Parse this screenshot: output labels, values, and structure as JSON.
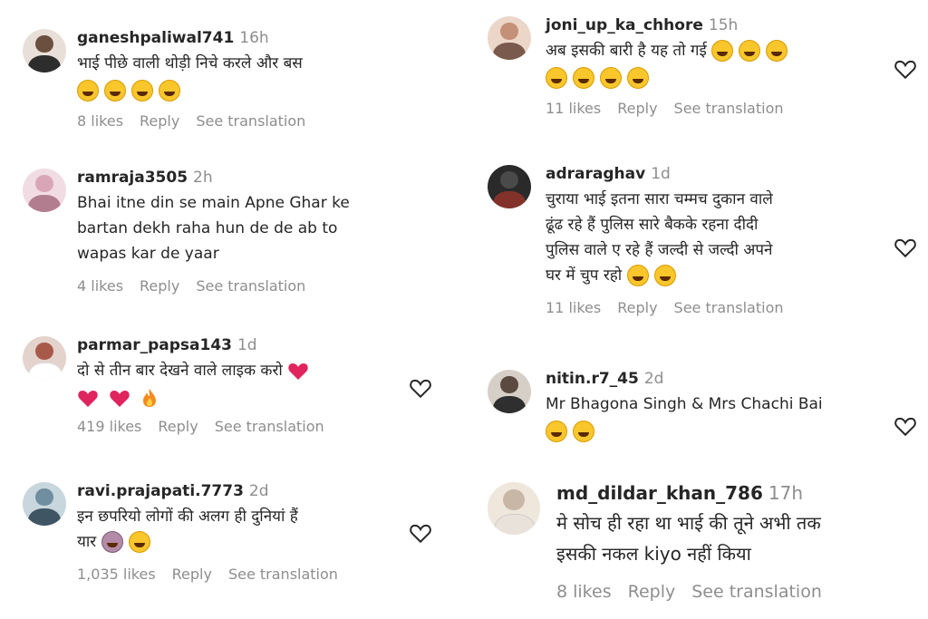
{
  "actions": {
    "reply": "Reply",
    "see_translation": "See translation"
  },
  "comments": [
    {
      "user": "ganeshpaliwal741",
      "time": "16h",
      "lines": [
        "भाई पीछे वाली थोड़ी निचे करले और बस"
      ],
      "emoji": [
        "grinning-squint-face",
        "grinning-squint-face",
        "grinning-squint-face",
        "grinning-squint-face"
      ],
      "likes": "8 likes",
      "avatar_color": "#6b4f3f"
    },
    {
      "user": "ramraja3505",
      "time": "2h",
      "lines": [
        "Bhai itne din se main Apne Ghar ke",
        "bartan dekh raha hun de de ab to",
        "wapas kar de yaar"
      ],
      "emoji": [],
      "likes": "4 likes",
      "avatar_color": "#d9a6b8"
    },
    {
      "user": "parmar_papsa143",
      "time": "1d",
      "lines": [
        "दो से तीन बार देखने वाले लाइक करो"
      ],
      "emoji": [
        "red-heart",
        "red-heart",
        "fire"
      ],
      "likes": "419 likes",
      "avatar_color": "#a85a4a"
    },
    {
      "user": "ravi.prajapati.7773",
      "time": "2d",
      "lines": [
        "इन छपरियो लोगों की अलग ही दुनियां हैं",
        "यार"
      ],
      "emoji": [
        "person-facepalming",
        "grinning-squint-face"
      ],
      "likes": "1,035 likes",
      "avatar_color": "#6f8ea0"
    },
    {
      "user": "joni_up_ka_chhore",
      "time": "15h",
      "lines": [
        "अब इसकी बारी है यह तो गई"
      ],
      "emoji": [
        "rolling-on-floor-laughing",
        "rolling-on-floor-laughing",
        "rolling-on-floor-laughing",
        "rolling-on-floor-laughing"
      ],
      "likes": "11 likes",
      "avatar_color": "#c49077"
    },
    {
      "user": "adraraghav",
      "time": "1d",
      "lines": [
        "चुराया भाई इतना सारा चम्मच दुकान वाले",
        "ढूंढ रहे हैं पुलिस सारे बैकके रहना दीदी",
        "पुलिस वाले ए रहे हैं जल्दी से जल्दी अपने",
        "घर में चुप रहो"
      ],
      "emoji": [],
      "likes": "11 likes",
      "avatar_color": "#3a3a3a"
    },
    {
      "user": "nitin.r7_45",
      "time": "2d",
      "lines": [
        "Mr Bhagona Singh & Mrs Chachi Bai"
      ],
      "emoji": [
        "rolling-on-floor-laughing",
        "grinning-squint-face"
      ],
      "likes": "",
      "avatar_color": "#5a4a40"
    },
    {
      "user": "md_dildar_khan_786",
      "time": "17h",
      "lines": [
        "मे सोच ही रहा था भाई की तूने अभी तक",
        "इसकी नकल kiyo नहीं किया"
      ],
      "emoji": [],
      "likes": "8 likes",
      "avatar_color": "#c8b7a6"
    }
  ],
  "colors": {
    "text": "#262626",
    "muted": "#8e8e8e",
    "heart_outline": "#262626",
    "emoji_yellow": "#f9c62b",
    "red_heart": "#e0245e"
  },
  "icons": {
    "like": "heart-outline-icon"
  }
}
